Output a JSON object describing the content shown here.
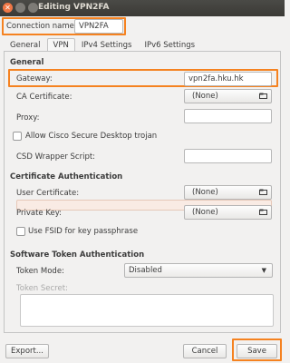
{
  "window": {
    "title": "Editing VPN2FA"
  },
  "connection": {
    "label": "Connection name:",
    "value": "VPN2FA"
  },
  "tabs": [
    {
      "label": "General"
    },
    {
      "label": "VPN"
    },
    {
      "label": "IPv4 Settings"
    },
    {
      "label": "IPv6 Settings"
    }
  ],
  "general": {
    "header": "General",
    "gateway_label": "Gateway:",
    "gateway_value": "vpn2fa.hku.hk",
    "ca_label": "CA Certificate:",
    "ca_value": "(None)",
    "proxy_label": "Proxy:",
    "proxy_value": "",
    "csd_label": "Allow Cisco Secure Desktop trojan",
    "wrapper_label": "CSD Wrapper Script:",
    "wrapper_value": ""
  },
  "cert": {
    "header": "Certificate Authentication",
    "user_cert_label": "User Certificate:",
    "user_cert_value": "(None)",
    "private_key_label": "Private Key:",
    "private_key_value": "(None)",
    "fsid_label": "Use FSID for key passphrase"
  },
  "token": {
    "header": "Software Token Authentication",
    "mode_label": "Token Mode:",
    "mode_value": "Disabled",
    "secret_label": "Token Secret:"
  },
  "buttons": {
    "export": "Export...",
    "cancel": "Cancel",
    "save": "Save"
  },
  "colors": {
    "highlight": "#f58220",
    "titlebar": "#3c3b37",
    "close": "#f07746"
  }
}
